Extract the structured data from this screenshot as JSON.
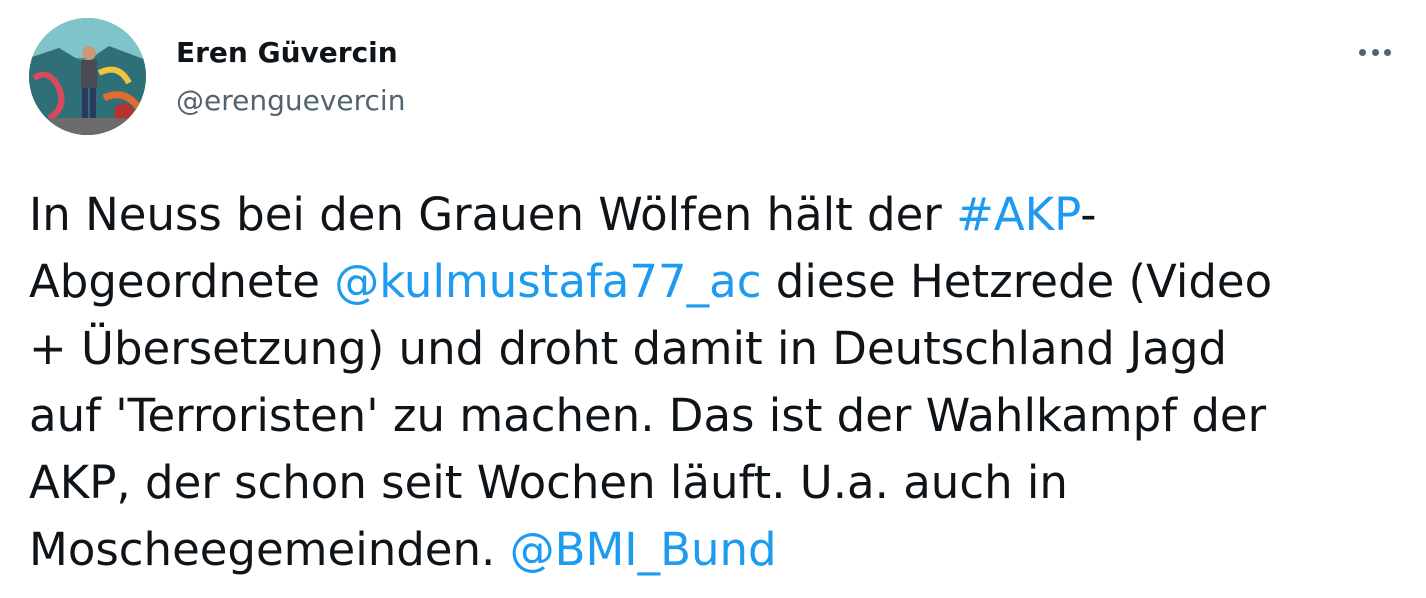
{
  "author": {
    "display_name": "Eren Güvercin",
    "handle": "@erenguevercin"
  },
  "menu": {
    "icon": "more-horizontal-icon"
  },
  "tweet": {
    "line1_a": "In Neuss bei den Grauen Wölfen hält der ",
    "hashtag_akp": "#AKP",
    "line1_b": "-",
    "line2_a": "Abgeordnete ",
    "mention_kulmustafa": "@kulmustafa77_ac",
    "line2_b": " diese Hetzrede (Video",
    "line3": "+ Übersetzung) und droht damit in Deutschland Jagd",
    "line4": "auf 'Terroristen' zu machen. Das ist der Wahlkampf der",
    "line5": "AKP, der schon seit Wochen läuft. U.a. auch in",
    "line6_a": "Moscheegemeinden. ",
    "mention_bmi": "@BMI_Bund"
  },
  "colors": {
    "text": "#0f1419",
    "secondary": "#536471",
    "link": "#1d9bf0"
  }
}
